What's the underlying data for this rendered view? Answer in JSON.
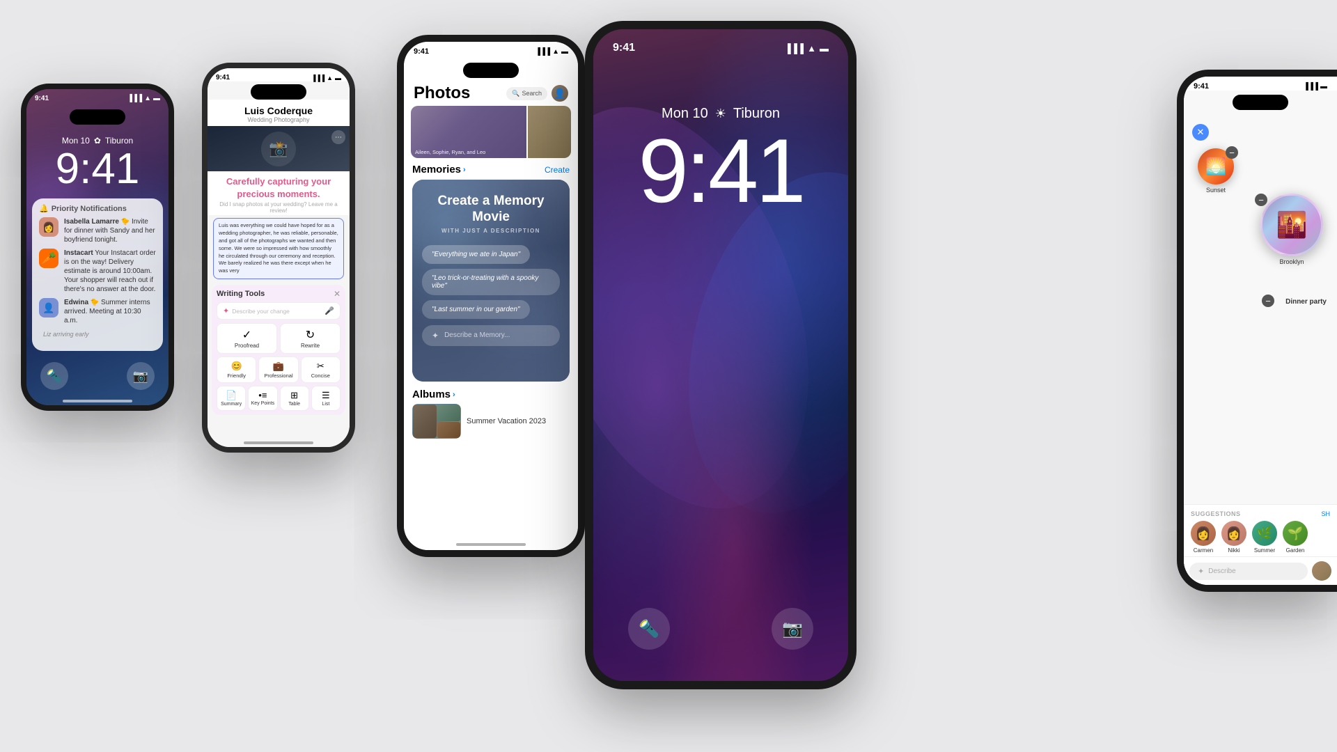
{
  "background_color": "#e8e8ea",
  "phone1": {
    "time": "9:41",
    "date": "Mon 10",
    "location": "Tiburon",
    "notifications_label": "Priority Notifications",
    "notif1": {
      "sender": "Isabella Lamarre",
      "text": "Invite for dinner with Sandy and her boyfriend tonight."
    },
    "notif2": {
      "sender": "Instacart",
      "text": "Your Instacart order is on the way! Delivery estimate is around 10:00am. Your shopper will reach out if there's no answer at the door."
    },
    "notif3": {
      "sender": "Edwina",
      "text": "Summer interns arrived. Meeting at 10:30 a.m."
    },
    "notif4": {
      "text": "Liz arriving early"
    }
  },
  "phone2": {
    "status_time": "9:41",
    "photographer_name": "Luis Coderque",
    "photographer_sub": "Wedding Photography",
    "tagline_line1": "Carefully capturing your",
    "tagline_line2": "precious moments.",
    "review_prompt": "Did I snap photos at your wedding? Leave me a review!",
    "review_text": "Luis was everything we could have hoped for as a wedding photographer, he was reliable, personable, and got all of the photographs we wanted and then some. We were so impressed with how smoothly he circulated through our ceremony and reception. We barely realized he was there except when he was very",
    "writing_tools_title": "Writing Tools",
    "writing_tools_placeholder": "Describe your change",
    "btn_proofread": "Proofread",
    "btn_rewrite": "Rewrite",
    "btn_friendly": "Friendly",
    "btn_professional": "Professional",
    "btn_concise": "Concise",
    "btn_summary": "Summary",
    "btn_key_points": "Key Points",
    "btn_table": "Table",
    "btn_list": "List"
  },
  "phone3": {
    "status_time": "9:41",
    "title": "Photos",
    "search_label": "Search",
    "hero_names": "Aileen, Sophie, Ryan, and Leo",
    "memories_label": "Memories",
    "create_label": "Create",
    "memory_movie_title": "Create a Memory Movie",
    "memory_movie_sub": "WITH JUST A DESCRIPTION",
    "chip1": "\"Everything we ate in Japan\"",
    "chip2": "\"Leo trick-or-treating with a spooky vibe\"",
    "chip3": "\"Last summer in our garden\"",
    "memory_input_placeholder": "Describe a Memory...",
    "albums_label": "Albums",
    "album1_name": "Summer Vacation 2023"
  },
  "phone4": {
    "status_time": "9:41",
    "date": "Mon 10",
    "location": "Tiburon",
    "time": "9:41",
    "sun_icon": "☀"
  },
  "phone5": {
    "status_time": "9:41",
    "brooklyn_label": "Brooklyn",
    "minus_icon": "−",
    "dinner_party_label": "Dinner party",
    "sunset_label": "Sunset",
    "suggestions_title": "SUGGESTIONS",
    "show_all": "SH",
    "suggest1": "Carmen",
    "suggest2": "Nikki",
    "suggest3": "Summer",
    "suggest4": "Garden",
    "describe_placeholder": "Describe"
  }
}
